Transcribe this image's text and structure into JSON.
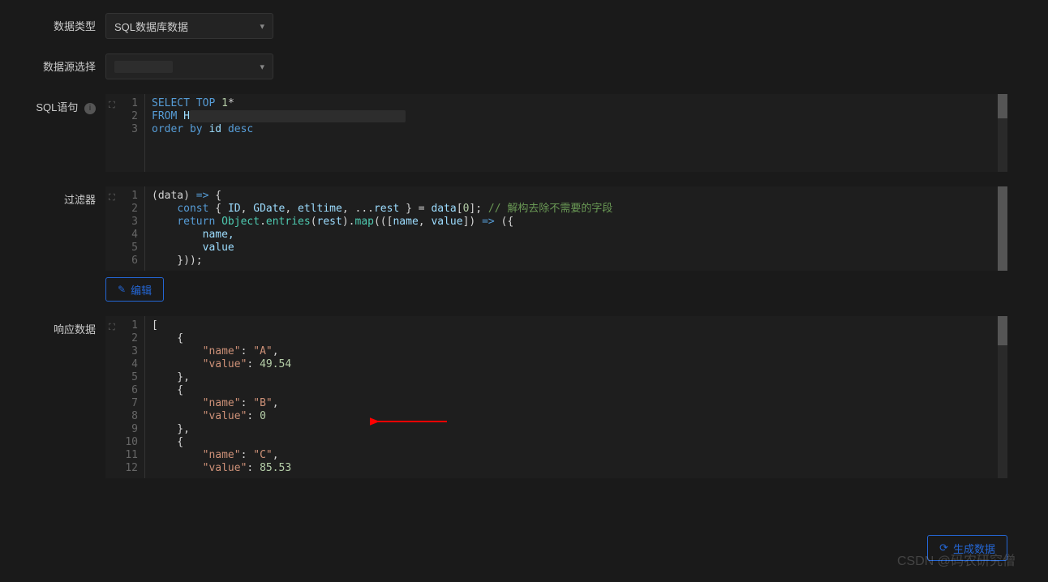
{
  "form": {
    "dataType": {
      "label": "数据类型",
      "value": "SQL数据库数据"
    },
    "dataSource": {
      "label": "数据源选择",
      "value": ""
    },
    "sql": {
      "label": "SQL语句"
    },
    "filter": {
      "label": "过滤器"
    },
    "response": {
      "label": "响应数据"
    }
  },
  "sqlEditor": {
    "lines": [
      "1",
      "2",
      "3"
    ],
    "tokens": {
      "select": "SELECT",
      "top": "TOP",
      "top_n": "1",
      "star": "*",
      "from": "FROM",
      "from_val": "H",
      "order": "order by",
      "order_col": "id",
      "desc": "desc"
    }
  },
  "filterEditor": {
    "lines": [
      "1",
      "2",
      "3",
      "4",
      "5",
      "6"
    ],
    "code": {
      "l1_a": "(data) ",
      "l1_b": "=>",
      "l1_c": " {",
      "l2_a": "    ",
      "l2_const": "const",
      "l2_b": " { ",
      "l2_id1": "ID",
      "l2_c": ", ",
      "l2_id2": "GDate",
      "l2_d": ", ",
      "l2_id3": "etltime",
      "l2_e": ", ...",
      "l2_id4": "rest",
      "l2_f": " } = ",
      "l2_id5": "data",
      "l2_g": "[",
      "l2_num": "0",
      "l2_h": "]; ",
      "l2_cmt": "// 解构去除不需要的字段",
      "l3_a": "    ",
      "l3_ret": "return",
      "l3_b": " ",
      "l3_obj": "Object",
      "l3_c": ".",
      "l3_fn1": "entries",
      "l3_d": "(",
      "l3_id1": "rest",
      "l3_e": ").",
      "l3_fn2": "map",
      "l3_f": "(([",
      "l3_id2": "name",
      "l3_g": ", ",
      "l3_id3": "value",
      "l3_h": "]) ",
      "l3_arr": "=>",
      "l3_i": " ({",
      "l4": "        name,",
      "l5": "        value",
      "l6": "    }));"
    }
  },
  "responseEditor": {
    "lines": [
      "1",
      "2",
      "3",
      "4",
      "5",
      "6",
      "7",
      "8",
      "9",
      "10",
      "11",
      "12"
    ],
    "tokens": {
      "l1": "[",
      "l2": "    {",
      "k_name": "\"name\"",
      "k_value": "\"value\"",
      "v_a": "\"A\"",
      "v_a_val": "49.54",
      "v_b": "\"B\"",
      "v_b_val": "0",
      "v_c": "\"C\"",
      "v_c_val": "85.53",
      "colon": ": ",
      "comma": ",",
      "close_obj": "    },",
      "open_obj": "    {"
    }
  },
  "buttons": {
    "edit": "编辑",
    "generate": "生成数据"
  },
  "watermark": "CSDN @码农研究僧"
}
